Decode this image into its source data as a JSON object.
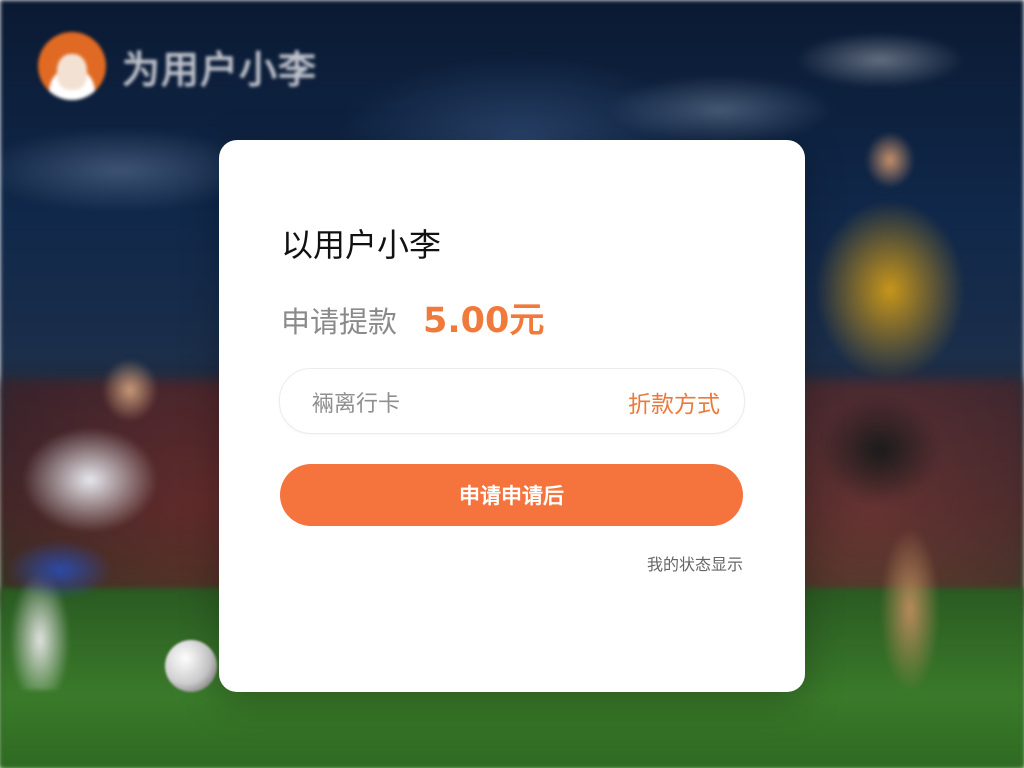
{
  "brand": {
    "name": "为用户小李",
    "avatar_icon": "user-avatar-icon"
  },
  "card": {
    "title": "以用户小李",
    "amount_label": "申请提款",
    "amount_value": "5.00元",
    "method_value": "裲离行卡",
    "method_link": "折款方式",
    "submit_label": "申请申请后",
    "status_link": "我的状态显示"
  },
  "colors": {
    "accent": "#f5733c",
    "amount": "#f07a3b",
    "card_bg": "#ffffff"
  }
}
